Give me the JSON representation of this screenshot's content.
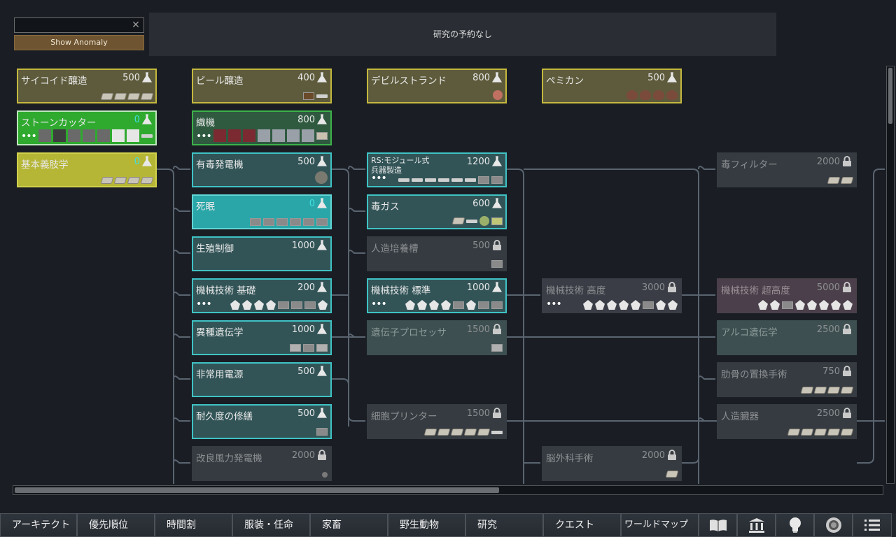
{
  "search": {
    "value": "",
    "clear_icon": "close-icon"
  },
  "anomaly_button": "Show Anomaly",
  "queue": {
    "text": "研究の予約なし"
  },
  "projects": [
    {
      "id": "psychoid",
      "label": "サイコイド醸造",
      "cost": "500",
      "style": "n-yellow",
      "cost_icon": "flask-icon",
      "icons": [
        "chip",
        "chip",
        "chip",
        "chip"
      ]
    },
    {
      "id": "beer",
      "label": "ビール醸造",
      "cost": "400",
      "style": "n-yellow",
      "cost_icon": "flask-icon",
      "icons": [
        "barrel",
        "bottle"
      ]
    },
    {
      "id": "devilstrand",
      "label": "デビルストランド",
      "cost": "800",
      "style": "n-yellow",
      "cost_icon": "flask-icon",
      "icons": [
        "mushroom"
      ]
    },
    {
      "id": "pemmican",
      "label": "ペミカン",
      "cost": "500",
      "style": "n-yellow",
      "cost_icon": "flask-icon",
      "icons": [
        "meat",
        "meat",
        "meat",
        "meat"
      ]
    },
    {
      "id": "stonecutting",
      "label": "ストーンカッター",
      "cost": "0",
      "style": "n-green",
      "cost_icon": "flask-icon",
      "dots": "•••",
      "icons": [
        "block-gray",
        "block-dark",
        "block-gray",
        "block-gray",
        "block-gray",
        "block-white",
        "block-white",
        "tool"
      ]
    },
    {
      "id": "loom",
      "label": "織機",
      "cost": "800",
      "style": "n-green2",
      "cost_icon": "flask-icon",
      "dots": "•••",
      "icons": [
        "red",
        "red",
        "red",
        "fabric",
        "fabric",
        "fabric",
        "fabric",
        "cloth"
      ]
    },
    {
      "id": "prosthetics",
      "label": "基本義肢学",
      "cost": "0",
      "style": "n-olive",
      "cost_icon": "flask-icon",
      "icons": [
        "chip",
        "chip",
        "chip",
        "chip"
      ]
    },
    {
      "id": "toxgen",
      "label": "有毒発電機",
      "cost": "500",
      "style": "n-teal",
      "cost_icon": "flask-icon",
      "icons": [
        "generator"
      ]
    },
    {
      "id": "deathrest",
      "label": "死眠",
      "cost": "0",
      "style": "n-tealsel",
      "cost_icon": "flask-icon",
      "icons": [
        "box",
        "box",
        "box",
        "box",
        "box",
        "box"
      ]
    },
    {
      "id": "growth",
      "label": "生殖制御",
      "cost": "1000",
      "style": "n-teal",
      "cost_icon": "flask-icon",
      "icons": []
    },
    {
      "id": "mechbasic",
      "label": "機械技術 基礎",
      "cost": "200",
      "style": "n-teal",
      "cost_icon": "flask-icon",
      "dots": "•••",
      "icons": [
        "mech",
        "mech",
        "mech",
        "mech",
        "box",
        "box",
        "box",
        "mech"
      ]
    },
    {
      "id": "xenogen",
      "label": "異種遺伝学",
      "cost": "1000",
      "style": "n-teal",
      "cost_icon": "flask-icon",
      "icons": [
        "machine",
        "box",
        "machine"
      ]
    },
    {
      "id": "battery",
      "label": "非常用電源",
      "cost": "500",
      "style": "n-teal",
      "cost_icon": "flask-icon",
      "icons": []
    },
    {
      "id": "repair",
      "label": "耐久度の修繕",
      "cost": "500",
      "style": "n-teal",
      "cost_icon": "flask-icon",
      "icons": [
        "box"
      ]
    },
    {
      "id": "windturbine",
      "label": "改良風力発電機",
      "cost": "2000",
      "style": "n-locked",
      "cost_icon": "lock-icon",
      "icons": [
        "small"
      ]
    },
    {
      "id": "modular",
      "label": "RS:モジュール式\n兵器製造",
      "cost": "1200",
      "style": "n-teal",
      "cost_icon": "flask-icon",
      "dots": "•••",
      "small": true,
      "icons": [
        "gun",
        "gun",
        "gun",
        "gun",
        "gun",
        "gun",
        "box",
        "box"
      ]
    },
    {
      "id": "toxgas",
      "label": "毒ガス",
      "cost": "600",
      "style": "n-teal",
      "cost_icon": "flask-icon",
      "icons": [
        "chip",
        "gun",
        "orb",
        "leaf"
      ]
    },
    {
      "id": "vat",
      "label": "人造培養槽",
      "cost": "500",
      "style": "n-locked",
      "cost_icon": "lock-icon",
      "icons": [
        "box"
      ]
    },
    {
      "id": "mechstd",
      "label": "機械技術 標準",
      "cost": "1000",
      "style": "n-teal",
      "cost_icon": "flask-icon",
      "dots": "•••",
      "icons": [
        "mech",
        "mech",
        "mech",
        "mech",
        "box",
        "mech",
        "box",
        "box"
      ]
    },
    {
      "id": "geneproc",
      "label": "遺伝子プロセッサ",
      "cost": "1500",
      "style": "n-lockteal",
      "cost_icon": "lock-icon",
      "icons": [
        "machine"
      ]
    },
    {
      "id": "cellprinter",
      "label": "細胞プリンター",
      "cost": "1500",
      "style": "n-locked",
      "cost_icon": "lock-icon",
      "icons": [
        "chip",
        "chip",
        "chip",
        "chip",
        "chip",
        "tool"
      ]
    },
    {
      "id": "mechhigh",
      "label": "機械技術 高度",
      "cost": "3000",
      "style": "n-lockdark",
      "cost_icon": "lock-icon",
      "dots": "•••",
      "icons": [
        "mech",
        "mech",
        "mech",
        "mech",
        "mech",
        "box",
        "mech",
        "mech"
      ]
    },
    {
      "id": "brainsurg",
      "label": "脳外科手術",
      "cost": "2000",
      "style": "n-locked",
      "cost_icon": "lock-icon",
      "icons": [
        "chip"
      ]
    },
    {
      "id": "toxfilter",
      "label": "毒フィルター",
      "cost": "2000",
      "style": "n-locked",
      "cost_icon": "lock-icon",
      "icons": [
        "chip",
        "chip"
      ]
    },
    {
      "id": "mechultra",
      "label": "機械技術 超高度",
      "cost": "5000",
      "style": "n-lockmauve",
      "cost_icon": "lock-icon",
      "icons": [
        "mech",
        "mech",
        "box",
        "mech",
        "mech",
        "mech",
        "mech",
        "mech"
      ]
    },
    {
      "id": "archogen",
      "label": "アルコ遺伝学",
      "cost": "2500",
      "style": "n-lockteal",
      "cost_icon": "lock-icon",
      "icons": []
    },
    {
      "id": "ribs",
      "label": "肋骨の置換手術",
      "cost": "750",
      "style": "n-locked",
      "cost_icon": "lock-icon",
      "icons": [
        "chip",
        "chip",
        "chip",
        "chip"
      ]
    },
    {
      "id": "organs",
      "label": "人造臓器",
      "cost": "2500",
      "style": "n-locked",
      "cost_icon": "lock-icon",
      "icons": [
        "chip",
        "chip",
        "chip",
        "chip",
        "chip"
      ]
    }
  ],
  "tabs": [
    {
      "label": "アーキテクト"
    },
    {
      "label": "優先順位"
    },
    {
      "label": "時間割"
    },
    {
      "label": "服装・任命"
    },
    {
      "label": "家畜"
    },
    {
      "label": "野生動物"
    },
    {
      "label": "研究"
    },
    {
      "label": "クエスト"
    },
    {
      "label": "ワールドマップ"
    }
  ],
  "icon_tabs": [
    {
      "icon": "book-icon"
    },
    {
      "icon": "factions-icon"
    },
    {
      "icon": "lightbulb-icon"
    },
    {
      "icon": "ideology-icon"
    },
    {
      "icon": "menu-icon"
    }
  ]
}
